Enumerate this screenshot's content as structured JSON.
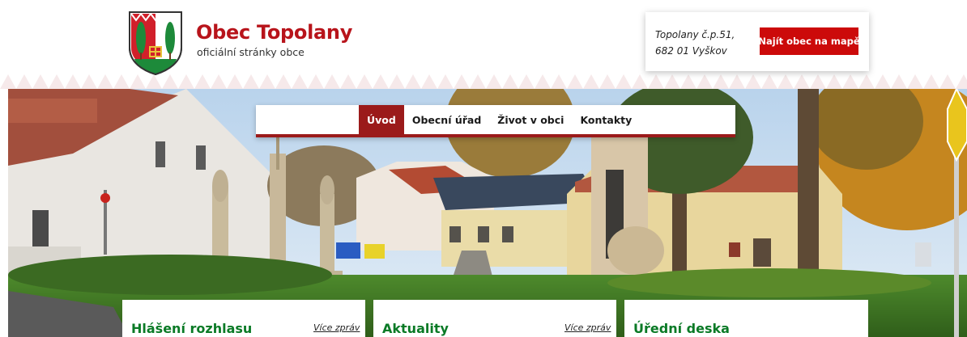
{
  "brand": {
    "title": "Obec Topolany",
    "subtitle": "oficiální stránky obce",
    "crest_icon": "municipal-crest-icon",
    "title_color": "#b8141b"
  },
  "contact": {
    "address_line1": "Topolany č.p.51,",
    "address_line2": "682 01 Vyškov",
    "map_button_label": "Najít obec na mapě",
    "button_color": "#cc0a0a"
  },
  "nav": {
    "items": [
      {
        "label": "Úvod",
        "active": true
      },
      {
        "label": "Obecní úřad",
        "active": false
      },
      {
        "label": "Život v obci",
        "active": false
      },
      {
        "label": "Kontakty",
        "active": false
      }
    ],
    "accent_color": "#9b1a1a"
  },
  "cards": [
    {
      "title": "Hlášení rozhlasu",
      "more_label": "Více zpráv"
    },
    {
      "title": "Aktuality",
      "more_label": "Více zpráv"
    },
    {
      "title": "Úřední deska"
    }
  ],
  "colors": {
    "card_title": "#0a7a26"
  }
}
